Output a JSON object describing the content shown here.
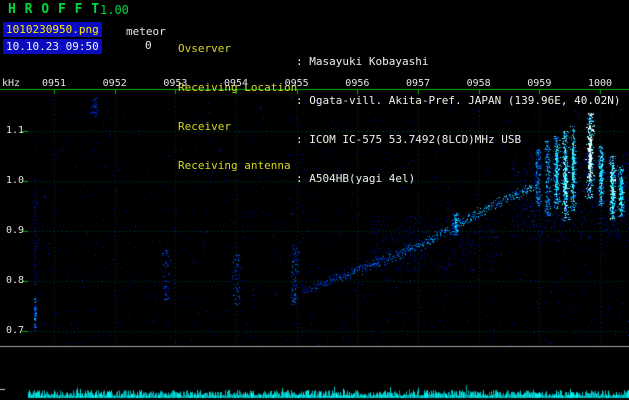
{
  "palette": {
    "title_green": "#00d840",
    "axis_green": "#00b400",
    "badge_blue": "#0a0ac0",
    "filename_yellow": "#ffee00",
    "info_label_yellow": "#d8d820",
    "grid_green": "#009669",
    "noise_blue": "#0030a0",
    "signal_cyan": "#00e8ff",
    "strip_cyan": "#00c8c8"
  },
  "app": {
    "title": "H R O F F T",
    "version": "1.00",
    "filename": "1010230950.png",
    "meteor_label": "meteor",
    "meteor_count": "0",
    "timestamp": "10.10.23 09:50"
  },
  "info_rows": [
    {
      "label": "Ovserver",
      "value": ": Masayuki Kobayashi"
    },
    {
      "label": "Receiving Location",
      "value": ": Ogata-vill. Akita-Pref. JAPAN (139.96E, 40.02N)"
    },
    {
      "label": "Receiver",
      "value": ": ICOM IC-575 53.7492(8LCD)MHz USB"
    },
    {
      "label": "Receiving antenna",
      "value": ": A504HB(yagi 4el)"
    }
  ],
  "chart_data": {
    "type": "heatmap",
    "ylabel": "kHz",
    "x_ticks": [
      "0951",
      "0952",
      "0953",
      "0954",
      "0955",
      "0956",
      "0957",
      "0958",
      "0959",
      "1000"
    ],
    "y_ticks": [
      "1.1",
      "1.0",
      "0.9",
      "0.8",
      "0.7"
    ],
    "y_range_khz": [
      0.67,
      1.18
    ],
    "grid": true,
    "events": [
      {
        "t": -0.31,
        "f_lo": 0.7,
        "f_hi": 1.0,
        "v": 0.28,
        "spread": 1.2,
        "n": 80
      },
      {
        "t": -0.31,
        "f_lo": 0.705,
        "f_hi": 0.765,
        "v": 0.55,
        "spread": 1.0,
        "n": 45
      },
      {
        "t": 0.68,
        "f_lo": 1.128,
        "f_hi": 1.168,
        "v": 0.35,
        "spread": 5,
        "n": 40
      },
      {
        "t": 1.85,
        "f_lo": 0.76,
        "f_hi": 0.862,
        "v": 0.38,
        "spread": 4,
        "n": 60
      },
      {
        "t": 3.02,
        "f_lo": 0.752,
        "f_hi": 0.855,
        "v": 0.42,
        "spread": 4,
        "n": 75
      },
      {
        "t": 3.97,
        "f_lo": 0.752,
        "f_hi": 0.872,
        "v": 0.46,
        "spread": 4,
        "n": 90
      },
      {
        "t": 6.62,
        "f_lo": 0.893,
        "f_hi": 0.936,
        "v": 0.7,
        "spread": 3,
        "n": 90
      },
      {
        "t": 7.98,
        "f_lo": 0.95,
        "f_hi": 1.065,
        "v": 0.6,
        "spread": 2.5,
        "n": 150
      },
      {
        "t": 8.14,
        "f_lo": 0.93,
        "f_hi": 1.08,
        "v": 0.68,
        "spread": 2.5,
        "n": 170
      },
      {
        "t": 8.29,
        "f_lo": 0.945,
        "f_hi": 1.09,
        "v": 0.76,
        "spread": 3,
        "n": 200
      },
      {
        "t": 8.43,
        "f_lo": 0.92,
        "f_hi": 1.1,
        "v": 0.86,
        "spread": 3,
        "n": 230
      },
      {
        "t": 8.56,
        "f_lo": 0.94,
        "f_hi": 1.11,
        "v": 0.8,
        "spread": 2.5,
        "n": 200
      },
      {
        "t": 8.84,
        "f_lo": 0.965,
        "f_hi": 1.135,
        "v": 1.0,
        "spread": 3.5,
        "n": 280
      },
      {
        "t": 9.02,
        "f_lo": 0.95,
        "f_hi": 1.07,
        "v": 0.8,
        "spread": 2.5,
        "n": 190
      },
      {
        "t": 9.21,
        "f_lo": 0.918,
        "f_hi": 1.05,
        "v": 0.86,
        "spread": 3,
        "n": 210
      },
      {
        "t": 9.35,
        "f_lo": 0.928,
        "f_hi": 1.03,
        "v": 0.78,
        "spread": 3,
        "n": 180
      }
    ],
    "clouds": [
      {
        "t_lo": 7.55,
        "t_hi": 9.5,
        "f_lo": 0.88,
        "f_hi": 1.06,
        "v": 0.3,
        "n": 650
      },
      {
        "t_lo": 5.2,
        "t_hi": 7.3,
        "f_lo": 0.82,
        "f_hi": 0.93,
        "v": 0.25,
        "n": 400
      }
    ],
    "trace": {
      "spread": 5,
      "points": [
        {
          "t": 4.1,
          "f": 0.78,
          "v": 0.35
        },
        {
          "t": 4.45,
          "f": 0.795,
          "v": 0.38
        },
        {
          "t": 4.8,
          "f": 0.812,
          "v": 0.42
        },
        {
          "t": 5.15,
          "f": 0.83,
          "v": 0.46
        },
        {
          "t": 5.5,
          "f": 0.845,
          "v": 0.5
        },
        {
          "t": 5.85,
          "f": 0.862,
          "v": 0.55
        },
        {
          "t": 6.2,
          "f": 0.882,
          "v": 0.6
        },
        {
          "t": 6.55,
          "f": 0.905,
          "v": 0.62
        },
        {
          "t": 6.9,
          "f": 0.93,
          "v": 0.65
        },
        {
          "t": 7.25,
          "f": 0.952,
          "v": 0.68
        },
        {
          "t": 7.6,
          "f": 0.972,
          "v": 0.7
        },
        {
          "t": 7.95,
          "f": 0.99,
          "v": 0.72
        }
      ]
    },
    "level_strip": {
      "content": "continuous receiver noise band"
    }
  }
}
